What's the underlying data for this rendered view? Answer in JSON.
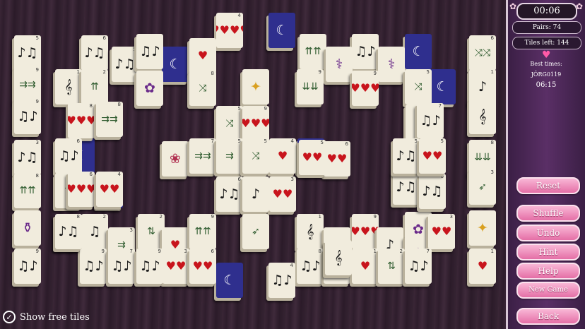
{
  "panel": {
    "timer": "00:06",
    "pairs_label": "Pairs: 74",
    "tiles_left_label": "Tiles left: 144",
    "best_times_label": "Best times:",
    "best_player": "JÖRG0119",
    "best_time": "06:15",
    "buttons": {
      "reset": "Reset",
      "shuffle": "Shuffle",
      "undo": "Undo",
      "hint": "Hint",
      "help": "Help",
      "new_game": "New Game",
      "back": "Back"
    }
  },
  "board": {
    "show_free_tiles_label": "Show free tiles",
    "show_free_tiles_checked": true,
    "tiles": [
      {
        "glyph": "♥♥♥♥",
        "kind": "heart",
        "num": "4"
      },
      {
        "glyph": "♪♫",
        "kind": "music",
        "num": "5"
      },
      {
        "glyph": "♪♫",
        "kind": "music",
        "num": "6"
      },
      {
        "glyph": "♪♫",
        "kind": "music",
        "num": "5"
      },
      {
        "glyph": "♥",
        "kind": "heart",
        "num": ""
      },
      {
        "glyph": "♫♪",
        "kind": "music",
        "num": ""
      },
      {
        "glyph": "⇈⇈",
        "kind": "arrow",
        "num": ""
      },
      {
        "glyph": "♫♪",
        "kind": "music",
        "num": ""
      },
      {
        "glyph": "⚕",
        "kind": "purple",
        "num": ""
      },
      {
        "glyph": "⚕",
        "kind": "purple",
        "num": ""
      },
      {
        "glyph": "⤨⤨",
        "kind": "arrow",
        "num": "6"
      },
      {
        "glyph": "⇉⇉",
        "kind": "arrow",
        "num": "9"
      },
      {
        "glyph": "𝄞",
        "kind": "music",
        "num": "1"
      },
      {
        "glyph": "⇈",
        "kind": "arrow",
        "num": "2"
      },
      {
        "glyph": "✿",
        "kind": "purple",
        "num": ""
      },
      {
        "glyph": "⤨",
        "kind": "arrow",
        "num": "8"
      },
      {
        "glyph": "✦",
        "kind": "bird",
        "num": ""
      },
      {
        "glyph": "⇊⇊",
        "kind": "arrow",
        "num": "9"
      },
      {
        "glyph": "♥♥♥",
        "kind": "heart",
        "num": "9"
      },
      {
        "glyph": "⤨",
        "kind": "arrow",
        "num": "5"
      },
      {
        "glyph": "♪",
        "kind": "music",
        "num": "1"
      },
      {
        "glyph": "♫♪",
        "kind": "music",
        "num": "9"
      },
      {
        "glyph": "♥♥♥",
        "kind": "heart",
        "num": "8"
      },
      {
        "glyph": "⇉⇉",
        "kind": "arrow",
        "num": "8"
      },
      {
        "glyph": "⤨",
        "kind": "arrow",
        "num": "5"
      },
      {
        "glyph": "♥♥♥",
        "kind": "heart",
        "num": "9"
      },
      {
        "glyph": "❀",
        "kind": "flower",
        "num": ""
      },
      {
        "glyph": "♪♫",
        "kind": "music",
        "num": "3"
      },
      {
        "glyph": "♫♪",
        "kind": "music",
        "num": "6"
      },
      {
        "glyph": "𝄞",
        "kind": "music",
        "num": ""
      },
      {
        "glyph": "⇊⇊",
        "kind": "arrow",
        "num": "8"
      },
      {
        "glyph": "♥",
        "kind": "heart",
        "num": "2"
      },
      {
        "glyph": "♫♪",
        "kind": "music",
        "num": "7"
      },
      {
        "glyph": "⇉⇉",
        "kind": "arrow",
        "num": "7"
      },
      {
        "glyph": "⇉",
        "kind": "arrow",
        "num": "5"
      },
      {
        "glyph": "♥",
        "kind": "heart",
        "num": "4"
      },
      {
        "glyph": "♥♥",
        "kind": "heart",
        "num": "6"
      },
      {
        "glyph": "⇈",
        "kind": "arrow",
        "num": "2"
      },
      {
        "glyph": "⇈⇈",
        "kind": "arrow",
        "num": "8"
      },
      {
        "glyph": "⤨",
        "kind": "arrow",
        "num": "5"
      },
      {
        "glyph": "♥♥♥",
        "kind": "heart",
        "num": "6"
      },
      {
        "glyph": "⚱",
        "kind": "purple",
        "num": ""
      },
      {
        "glyph": "♥♥",
        "kind": "heart",
        "num": "4"
      },
      {
        "glyph": "♥♥",
        "kind": "heart",
        "num": "3"
      },
      {
        "glyph": "♪♫",
        "kind": "music",
        "num": "6"
      },
      {
        "glyph": "♪",
        "kind": "music",
        "num": ""
      },
      {
        "glyph": "♥♥",
        "kind": "heart",
        "num": "5"
      },
      {
        "glyph": "♪♫",
        "kind": "music",
        "num": "7"
      },
      {
        "glyph": "➶",
        "kind": "arrow",
        "num": "3"
      },
      {
        "glyph": "✿",
        "kind": "purple",
        "num": ""
      },
      {
        "glyph": "♪♫",
        "kind": "music",
        "num": "6"
      },
      {
        "glyph": "♪♫",
        "kind": "music",
        "num": "5"
      },
      {
        "glyph": "♥♥",
        "kind": "heart",
        "num": "5"
      },
      {
        "glyph": "♫♪",
        "kind": "music",
        "num": "9"
      },
      {
        "glyph": "♫",
        "kind": "music",
        "num": "2"
      },
      {
        "glyph": "⇉",
        "kind": "arrow",
        "num": "3"
      },
      {
        "glyph": "⇅",
        "kind": "arrow",
        "num": "2"
      },
      {
        "glyph": "♥",
        "kind": "heart",
        "num": ""
      },
      {
        "glyph": "⇈⇈",
        "kind": "arrow",
        "num": "9"
      },
      {
        "glyph": "➶",
        "kind": "arrow",
        "num": ""
      },
      {
        "glyph": "♥♥♥",
        "kind": "heart",
        "num": "9"
      },
      {
        "glyph": "𝄞",
        "kind": "music",
        "num": "1"
      },
      {
        "glyph": "➶",
        "kind": "arrow",
        "num": ""
      },
      {
        "glyph": "♪",
        "kind": "music",
        "num": ""
      },
      {
        "glyph": "✦",
        "kind": "purple",
        "num": ""
      },
      {
        "glyph": "♥♥",
        "kind": "heart",
        "num": "3"
      },
      {
        "glyph": "♫♪",
        "kind": "music",
        "num": "9"
      },
      {
        "glyph": "♫♪",
        "kind": "music",
        "num": "7"
      },
      {
        "glyph": "♫♪",
        "kind": "music",
        "num": "8"
      },
      {
        "glyph": "♫♪",
        "kind": "music",
        "num": "9"
      },
      {
        "glyph": "♥",
        "kind": "heart",
        "num": "1"
      },
      {
        "glyph": "✦",
        "kind": "bird",
        "num": ""
      },
      {
        "glyph": "♥",
        "kind": "heart",
        "num": "1"
      },
      {
        "glyph": "⇅",
        "kind": "arrow",
        "num": "2"
      },
      {
        "glyph": "♪♫",
        "kind": "music",
        "num": "8"
      },
      {
        "glyph": "♫♪",
        "kind": "music",
        "num": "4"
      },
      {
        "glyph": "𝄞",
        "kind": "music",
        "num": ""
      },
      {
        "glyph": "♥♥",
        "kind": "heart",
        "num": "3"
      },
      {
        "glyph": "♥♥",
        "kind": "heart",
        "num": "6"
      },
      {
        "glyph": "♫♪",
        "kind": "music",
        "num": "7"
      },
      {
        "glyph": "♫♪",
        "kind": "music",
        "num": "9"
      }
    ]
  }
}
